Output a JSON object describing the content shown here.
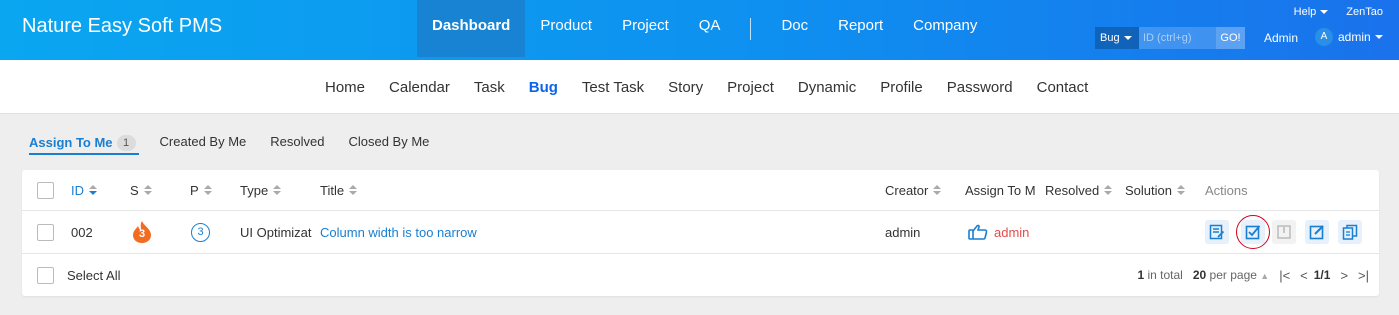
{
  "header": {
    "brand": "Nature Easy Soft PMS",
    "nav": [
      "Dashboard",
      "Product",
      "Project",
      "QA",
      "Doc",
      "Report",
      "Company"
    ],
    "help": "Help",
    "zentao": "ZenTao",
    "search_type": "Bug",
    "search_placeholder": "ID (ctrl+g)",
    "go": "GO!",
    "admin_link": "Admin",
    "avatar_letter": "A",
    "user": "admin"
  },
  "subnav": [
    "Home",
    "Calendar",
    "Task",
    "Bug",
    "Test Task",
    "Story",
    "Project",
    "Dynamic",
    "Profile",
    "Password",
    "Contact"
  ],
  "tabs": {
    "assign": "Assign To Me",
    "assign_count": "1",
    "created": "Created By Me",
    "resolved": "Resolved",
    "closed": "Closed By Me"
  },
  "table": {
    "headers": {
      "id": "ID",
      "s": "S",
      "p": "P",
      "type": "Type",
      "title": "Title",
      "creator": "Creator",
      "assign": "Assign To M",
      "resolved": "Resolved",
      "solution": "Solution",
      "actions": "Actions"
    },
    "row": {
      "id": "002",
      "severity": "3",
      "priority": "3",
      "type": "UI Optimizat",
      "title": "Column width is too narrow",
      "creator": "admin",
      "assignee": "admin"
    }
  },
  "footer": {
    "select_all": "Select All",
    "total_num": "1",
    "total_label": "in total",
    "per_page_num": "20",
    "per_page_label": "per page",
    "page": "1/1"
  },
  "colors": {
    "brand_blue": "#0e90f0",
    "link": "#1a7fd1",
    "severity": "#f26d21",
    "assignee": "#e84a4a",
    "highlight_ring": "#d0021b"
  }
}
